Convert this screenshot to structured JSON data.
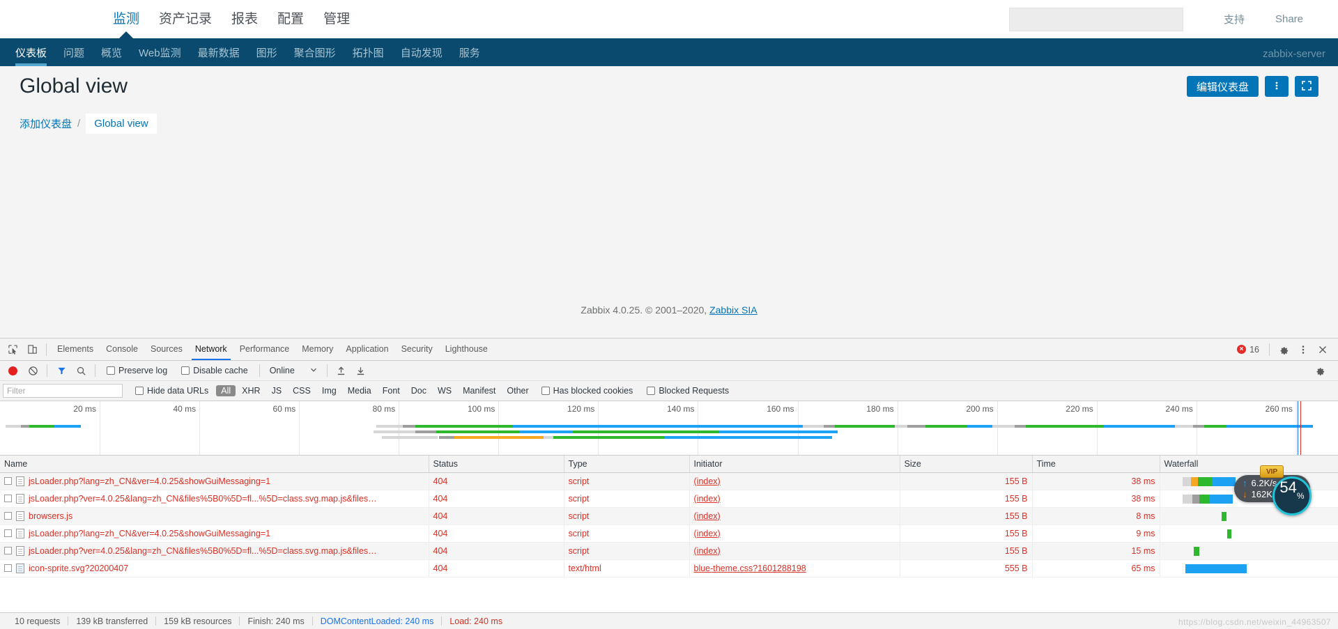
{
  "zabbix": {
    "top_menu": [
      {
        "label": "监测",
        "active": true
      },
      {
        "label": "资产记录",
        "active": false
      },
      {
        "label": "报表",
        "active": false
      },
      {
        "label": "配置",
        "active": false
      },
      {
        "label": "管理",
        "active": false
      }
    ],
    "search_placeholder": "",
    "search_value": "",
    "top_links": [
      {
        "label": "支持"
      },
      {
        "label": "Share"
      }
    ],
    "sub_menu": [
      {
        "label": "仪表板",
        "active": true
      },
      {
        "label": "问题",
        "active": false
      },
      {
        "label": "概览",
        "active": false
      },
      {
        "label": "Web监测",
        "active": false
      },
      {
        "label": "最新数据",
        "active": false
      },
      {
        "label": "图形",
        "active": false
      },
      {
        "label": "聚合图形",
        "active": false
      },
      {
        "label": "拓扑图",
        "active": false
      },
      {
        "label": "自动发现",
        "active": false
      },
      {
        "label": "服务",
        "active": false
      }
    ],
    "server_name": "zabbix-server",
    "page_title": "Global view",
    "edit_dashboard_label": "编辑仪表盘",
    "breadcrumb": {
      "add_dashboard": "添加仪表盘",
      "separator": "/",
      "current": "Global view"
    },
    "footer": {
      "text": "Zabbix 4.0.25. © 2001–2020, ",
      "link": "Zabbix SIA"
    }
  },
  "devtools": {
    "tabs": [
      {
        "label": "Elements",
        "active": false
      },
      {
        "label": "Console",
        "active": false
      },
      {
        "label": "Sources",
        "active": false
      },
      {
        "label": "Network",
        "active": true
      },
      {
        "label": "Performance",
        "active": false
      },
      {
        "label": "Memory",
        "active": false
      },
      {
        "label": "Application",
        "active": false
      },
      {
        "label": "Security",
        "active": false
      },
      {
        "label": "Lighthouse",
        "active": false
      }
    ],
    "error_count": "16",
    "toolbar": {
      "preserve_log": "Preserve log",
      "disable_cache": "Disable cache",
      "throttling": "Online"
    },
    "filterbar": {
      "filter_placeholder": "Filter",
      "filter_value": "",
      "hide_data_urls": "Hide data URLs",
      "types": [
        {
          "label": "All",
          "active": true
        },
        {
          "label": "XHR",
          "active": false
        },
        {
          "label": "JS",
          "active": false
        },
        {
          "label": "CSS",
          "active": false
        },
        {
          "label": "Img",
          "active": false
        },
        {
          "label": "Media",
          "active": false
        },
        {
          "label": "Font",
          "active": false
        },
        {
          "label": "Doc",
          "active": false
        },
        {
          "label": "WS",
          "active": false
        },
        {
          "label": "Manifest",
          "active": false
        },
        {
          "label": "Other",
          "active": false
        }
      ],
      "has_blocked_cookies": "Has blocked cookies",
      "blocked_requests": "Blocked Requests"
    },
    "overview": {
      "ticks": [
        "20 ms",
        "40 ms",
        "60 ms",
        "80 ms",
        "100 ms",
        "120 ms",
        "140 ms",
        "160 ms",
        "180 ms",
        "200 ms",
        "220 ms",
        "240 ms",
        "260 ms"
      ]
    },
    "table": {
      "columns": [
        "Name",
        "Status",
        "Type",
        "Initiator",
        "Size",
        "Time",
        "Waterfall"
      ],
      "rows": [
        {
          "name": "jsLoader.php?lang=zh_CN&ver=4.0.25&showGuiMessaging=1",
          "status": "404",
          "type": "script",
          "initiator": "(index)",
          "size": "155 B",
          "time": "38 ms",
          "icon": "script-file-icon"
        },
        {
          "name": "jsLoader.php?ver=4.0.25&lang=zh_CN&files%5B0%5D=fl...%5D=class.svg.map.js&files…",
          "status": "404",
          "type": "script",
          "initiator": "(index)",
          "size": "155 B",
          "time": "38 ms",
          "icon": "script-file-icon"
        },
        {
          "name": "browsers.js",
          "status": "404",
          "type": "script",
          "initiator": "(index)",
          "size": "155 B",
          "time": "8 ms",
          "icon": "script-file-icon"
        },
        {
          "name": "jsLoader.php?lang=zh_CN&ver=4.0.25&showGuiMessaging=1",
          "status": "404",
          "type": "script",
          "initiator": "(index)",
          "size": "155 B",
          "time": "9 ms",
          "icon": "script-file-icon"
        },
        {
          "name": "jsLoader.php?ver=4.0.25&lang=zh_CN&files%5B0%5D=fl...%5D=class.svg.map.js&files…",
          "status": "404",
          "type": "script",
          "initiator": "(index)",
          "size": "155 B",
          "time": "15 ms",
          "icon": "script-file-icon"
        },
        {
          "name": "icon-sprite.svg?20200407",
          "status": "404",
          "type": "text/html",
          "initiator": "blue-theme.css?1601288198",
          "size": "555 B",
          "time": "65 ms",
          "icon": "image-file-icon"
        }
      ]
    },
    "statusbar": {
      "requests": "10 requests",
      "transferred": "139 kB transferred",
      "resources": "159 kB resources",
      "finish": "Finish: 240 ms",
      "dom_content_loaded": "DOMContentLoaded: 240 ms",
      "load": "Load: 240 ms"
    },
    "watermark": "https://blog.csdn.net/weixin_44963507"
  },
  "net_widget": {
    "upload": "6.2K/s",
    "download": "162K/s",
    "percent": "54",
    "percent_unit": "%",
    "badge": "VIP"
  }
}
